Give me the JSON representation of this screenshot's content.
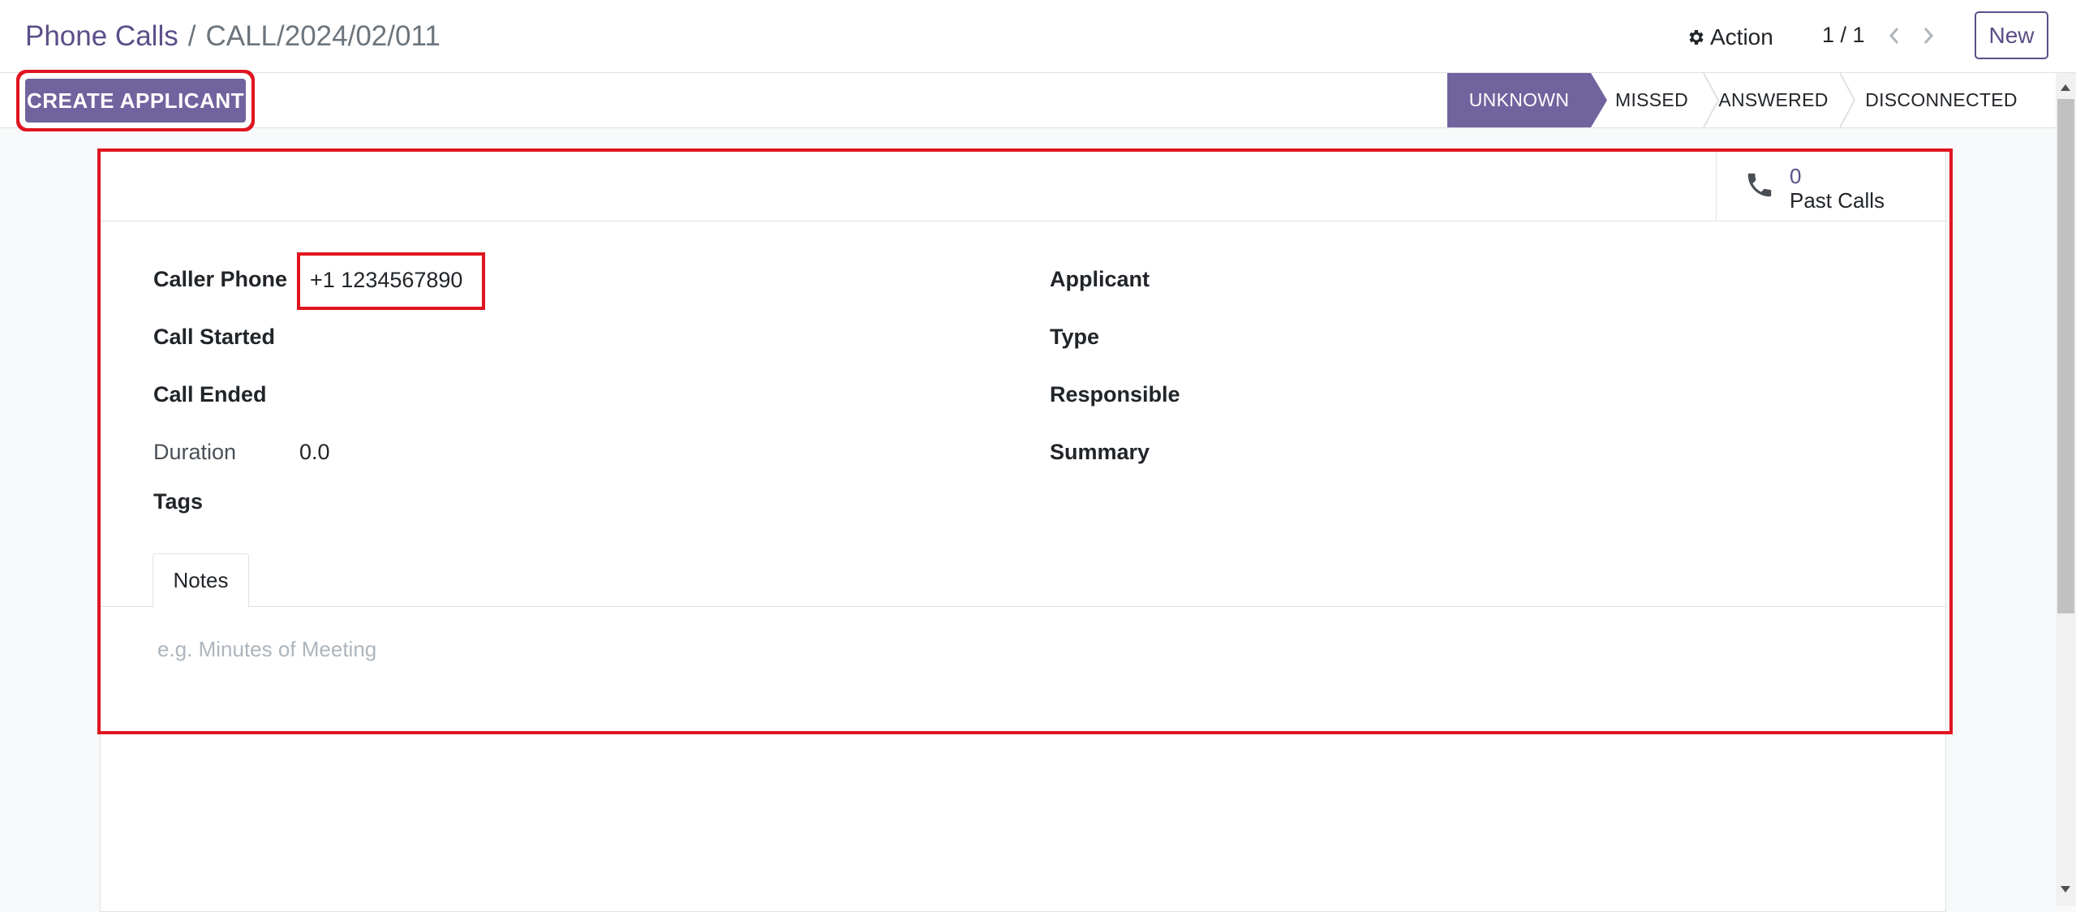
{
  "breadcrumb": {
    "parent": "Phone Calls",
    "separator": "/",
    "current": "CALL/2024/02/011"
  },
  "toolbar": {
    "action_label": "Action",
    "pager": "1 / 1",
    "new_label": "New"
  },
  "statusbar": {
    "create_applicant_label": "CREATE APPLICANT",
    "stages": [
      "UNKNOWN",
      "MISSED",
      "ANSWERED",
      "DISCONNECTED"
    ],
    "active_stage": "UNKNOWN"
  },
  "smart_button": {
    "count": "0",
    "label": "Past Calls",
    "icon": "phone-icon"
  },
  "fields": {
    "caller_phone_label": "Caller Phone",
    "caller_phone_value": "+1 1234567890",
    "call_started_label": "Call Started",
    "call_ended_label": "Call Ended",
    "duration_label": "Duration",
    "duration_value": "0.0",
    "tags_label": "Tags",
    "applicant_label": "Applicant",
    "type_label": "Type",
    "responsible_label": "Responsible",
    "summary_label": "Summary"
  },
  "tabs": {
    "notes_label": "Notes"
  },
  "notes": {
    "placeholder": "e.g. Minutes of Meeting"
  },
  "colors": {
    "brand": "#71639e",
    "link": "#5c4e88",
    "highlight": "#e0151f"
  }
}
